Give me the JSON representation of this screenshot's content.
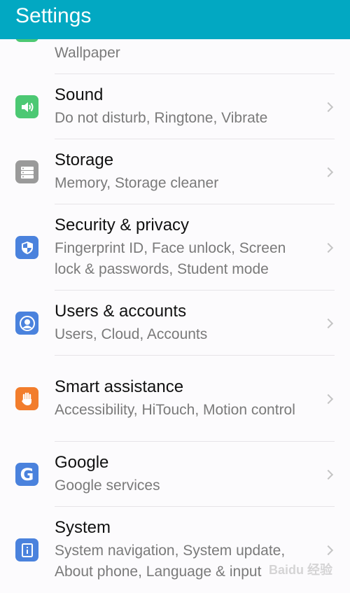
{
  "header": {
    "title": "Settings"
  },
  "partial_item": {
    "subtitle": "Wallpaper",
    "icon": "display-icon",
    "color": "#4cc873"
  },
  "items": [
    {
      "title": "Sound",
      "subtitle": "Do not disturb, Ringtone, Vibrate",
      "icon": "speaker-icon",
      "color": "#4cc873"
    },
    {
      "title": "Storage",
      "subtitle": "Memory, Storage cleaner",
      "icon": "storage-icon",
      "color": "#9a9a9a"
    },
    {
      "title": "Security & privacy",
      "subtitle": "Fingerprint ID, Face unlock, Screen lock & passwords, Student mode",
      "icon": "shield-icon",
      "color": "#4a82dd"
    },
    {
      "title": "Users & accounts",
      "subtitle": "Users, Cloud, Accounts",
      "icon": "user-icon",
      "color": "#4a82dd"
    },
    {
      "title": "Smart assistance",
      "subtitle": "Accessibility, HiTouch, Motion control",
      "icon": "hand-icon",
      "color": "#f27d2c"
    },
    {
      "title": "Google",
      "subtitle": "Google services",
      "icon": "google-icon",
      "color": "#4a82dd"
    },
    {
      "title": "System",
      "subtitle": "System navigation, System update, About phone, Language & input",
      "icon": "info-icon",
      "color": "#4a82dd"
    }
  ],
  "watermark": "Baidu 经验",
  "colors": {
    "header": "#02a8c2",
    "background": "#fcfbfd"
  }
}
